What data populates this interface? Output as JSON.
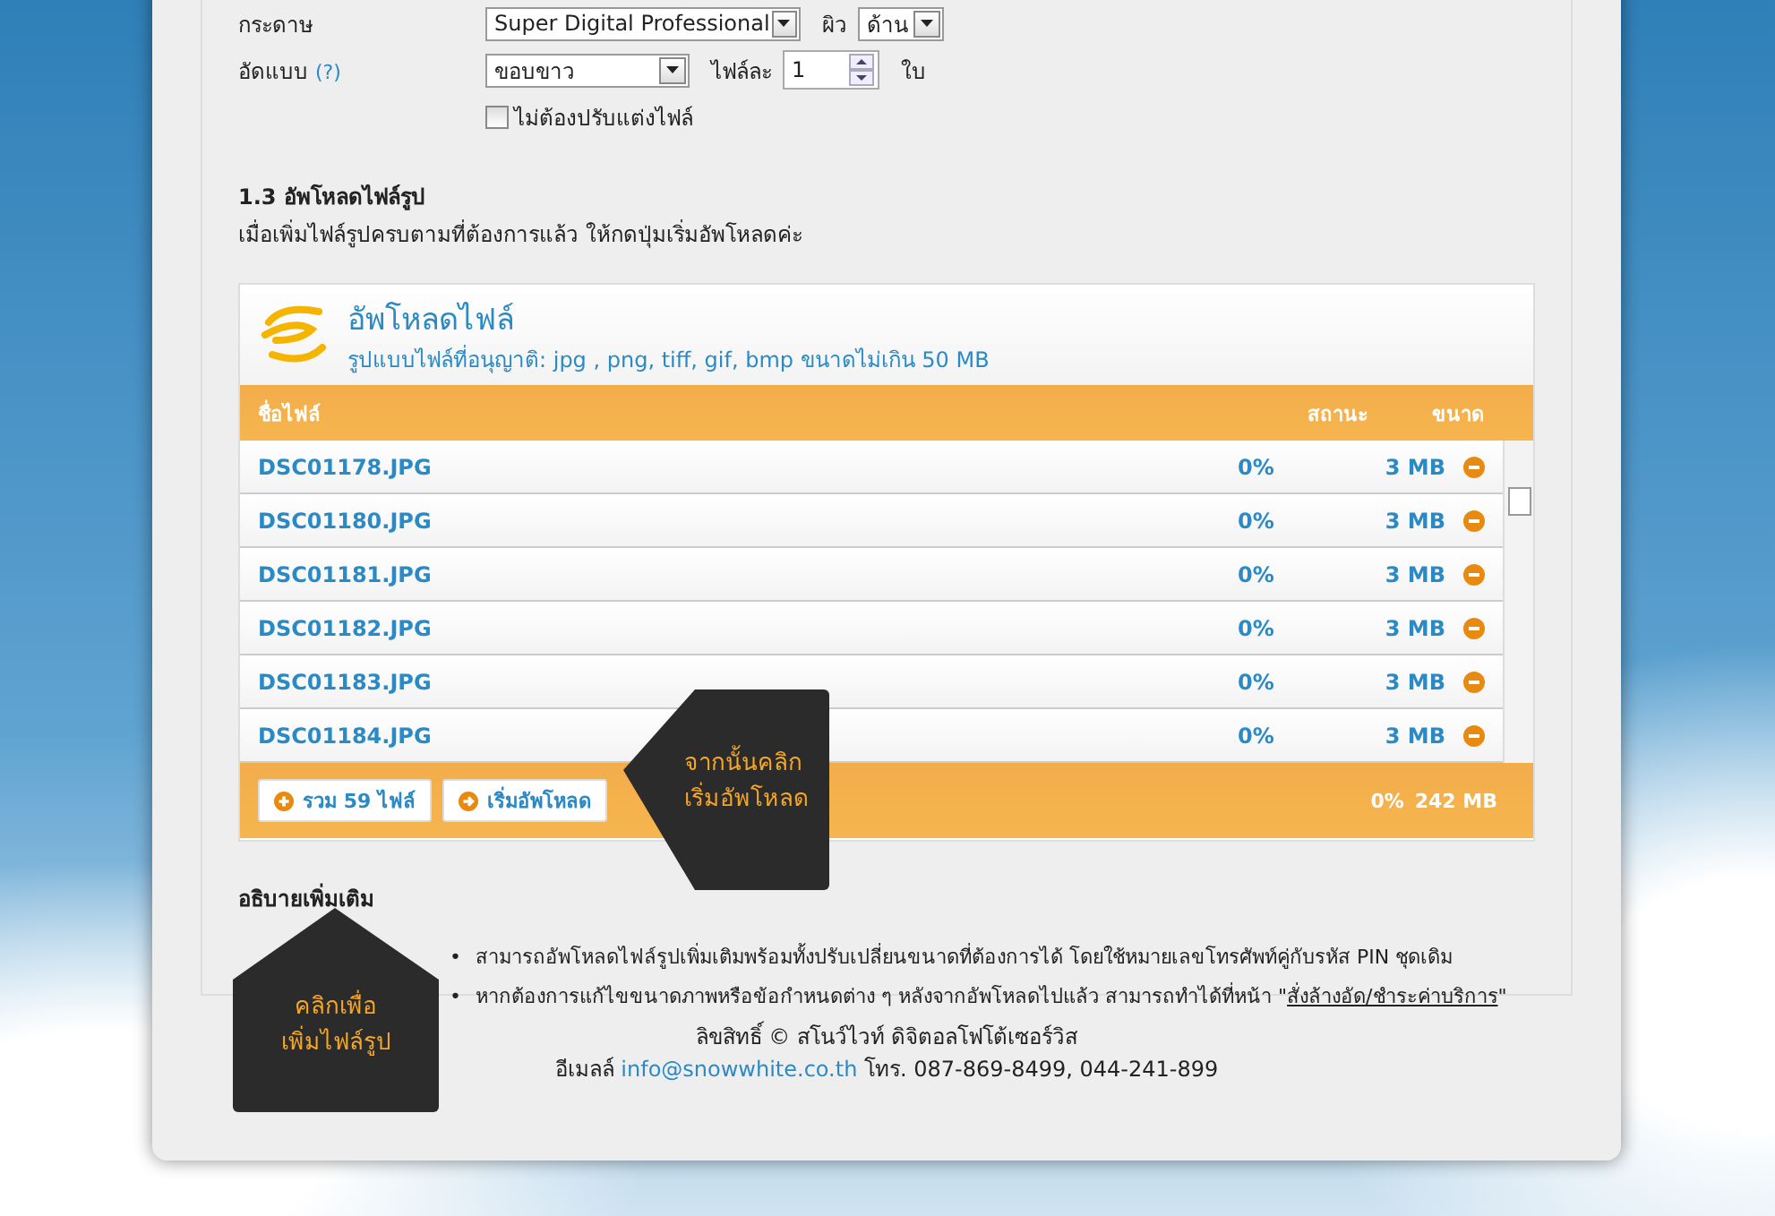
{
  "paper_row": {
    "label": "กระดาษ",
    "paper": "Super Digital Professional",
    "surface_label": "ผิว",
    "surface": "ด้าน"
  },
  "print_row": {
    "label": "อัดแบบ",
    "help": "(?)",
    "style": "ขอบขาว",
    "per_file_label": "ไฟล์ละ",
    "per_file": "1",
    "unit": "ใบ"
  },
  "no_adjust": {
    "label": "ไม่ต้องปรับแต่งไฟล์",
    "checked": false
  },
  "section": {
    "title": "1.3 อัพโหลดไฟล์รูป",
    "instruction": "เมื่อเพิ่มไฟล์รูปครบตามที่ต้องการแล้ว ให้กดปุ่มเริ่มอัพโหลดค่ะ"
  },
  "uploader": {
    "title": "อัพโหลดไฟล์",
    "formats": "รูปแบบไฟล์ที่อนุญาติ: jpg , png, tiff, gif, bmp ขนาดไม่เกิน 50 MB",
    "columns": [
      "ชื่อไฟล์",
      "สถานะ",
      "ขนาด"
    ],
    "files": [
      {
        "name": "DSC01178.JPG",
        "status": "0%",
        "size": "3 MB"
      },
      {
        "name": "DSC01180.JPG",
        "status": "0%",
        "size": "3 MB"
      },
      {
        "name": "DSC01181.JPG",
        "status": "0%",
        "size": "3 MB"
      },
      {
        "name": "DSC01182.JPG",
        "status": "0%",
        "size": "3 MB"
      },
      {
        "name": "DSC01183.JPG",
        "status": "0%",
        "size": "3 MB"
      },
      {
        "name": "DSC01184.JPG",
        "status": "0%",
        "size": "3 MB"
      }
    ],
    "add_button": "รวม 59 ไฟล์",
    "start_button": "เริ่มอัพโหลด",
    "total_status": "0%",
    "total_size": "242 MB"
  },
  "callouts": [
    {
      "text": "จากนั้นคลิก\nเริ่มอัพโหลด",
      "kind": "side"
    },
    {
      "text": "คลิกเพื่อ\nเพิ่มไฟล์รูป",
      "kind": "top"
    }
  ],
  "notes": {
    "title": "อธิบายเพิ่มเติม",
    "items": [
      {
        "bullet": "•",
        "text": "สามารถอัพโหลดไฟล์รูปเพิ่มเติมพร้อมทั้งปรับเปลี่ยนขนาดที่ต้องการได้ โดยใช้หมายเลขโทรศัพท์คู่กับรหัส PIN ชุดเดิม"
      },
      {
        "bullet": "•",
        "text": "หากต้องการแก้ไขขนาดภาพหรือข้อกำหนดต่าง ๆ หลังจากอัพโหลดไปแล้ว สามารถทำได้ที่หน้า \"",
        "link": "สั่งล้างอัด/ชำระค่าบริการ",
        "after": "\""
      }
    ]
  },
  "footer": {
    "copyright": "ลิขสิทธิ์ © สโนว์ไวท์ ดิจิตอลโฟโต้เซอร์วิส",
    "email_label": "อีเมลล์",
    "email": "info@snowwhite.co.th",
    "phone": "โทร. 087-869-8499, 044-241-899"
  }
}
